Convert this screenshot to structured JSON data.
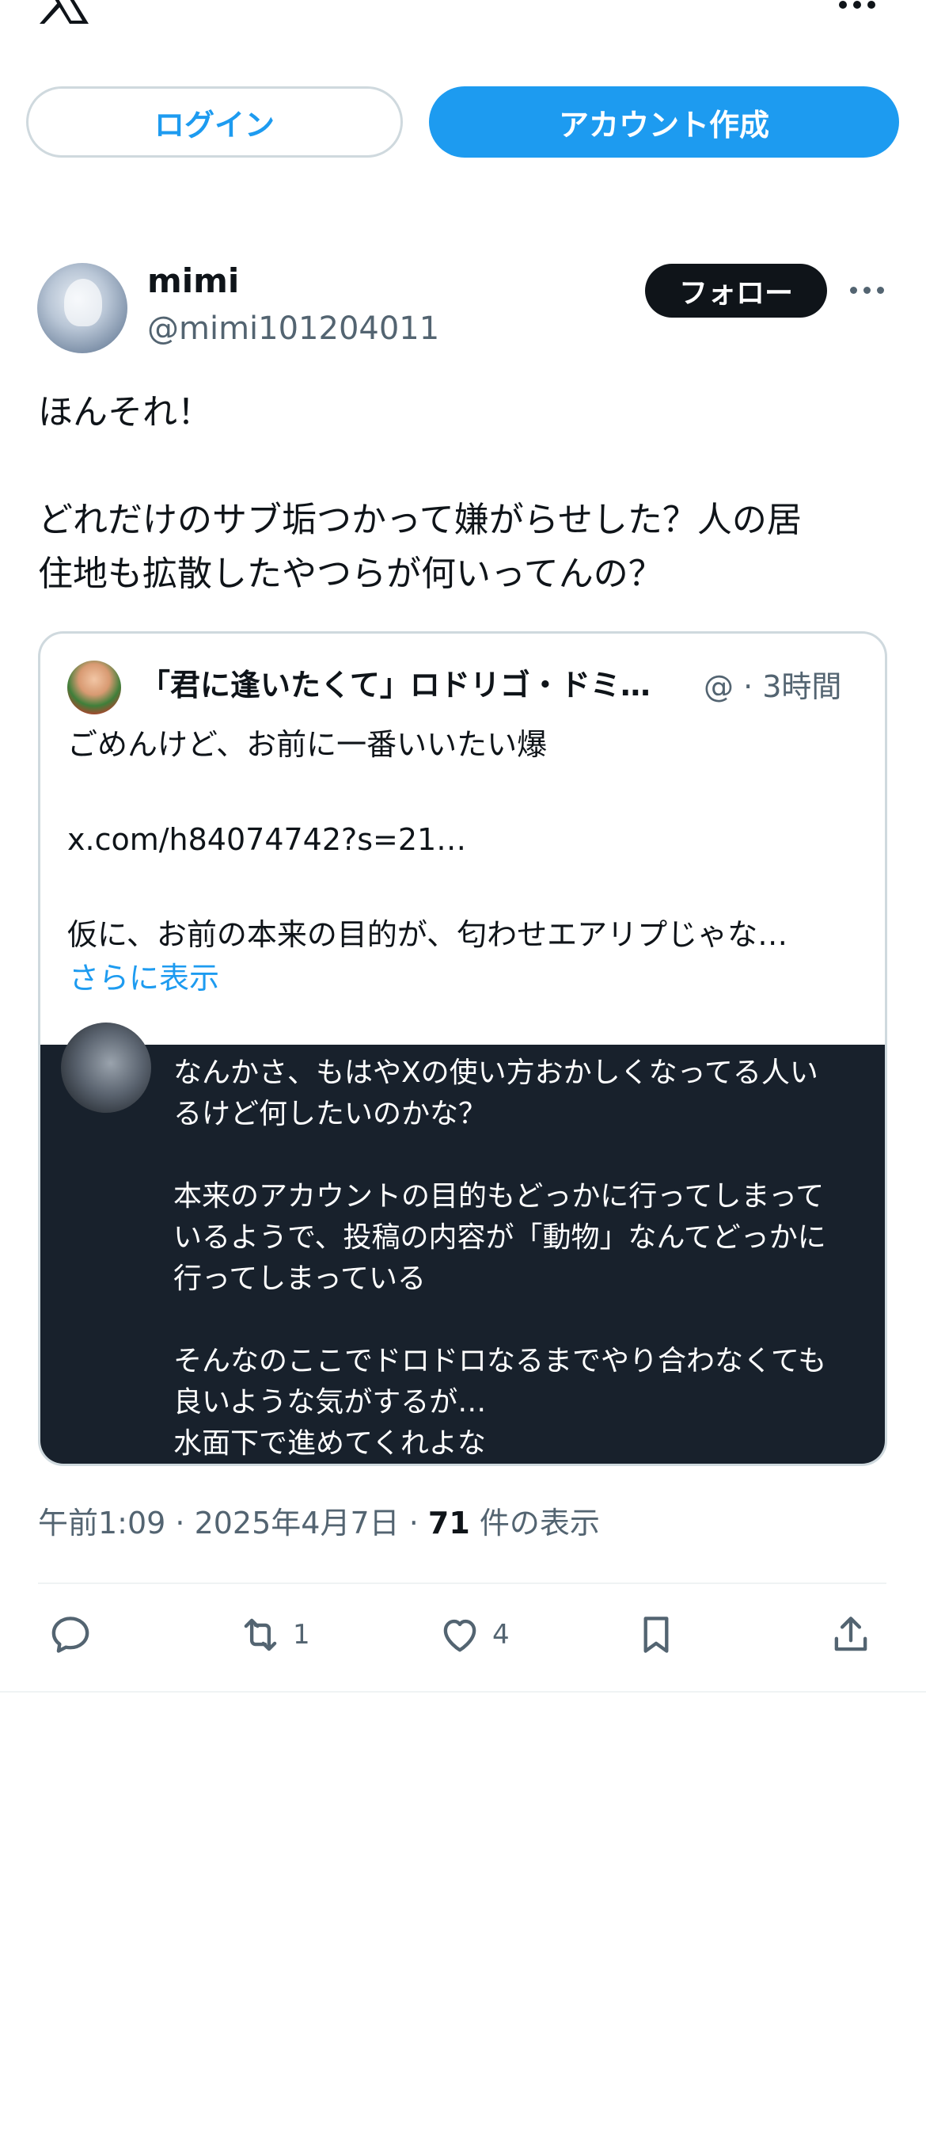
{
  "header": {
    "logo_icon": "x-logo-icon",
    "more_icon": "more-horizontal-icon",
    "login_label": "ログイン",
    "signup_label": "アカウント作成"
  },
  "post": {
    "author_name": "mimi",
    "author_handle": "@mimi101204011",
    "follow_label": "フォロー",
    "text": "ほんそれ！\n\nどれだけのサブ垢つかって嫌がらせした？人の居\n住地も拡散したやつらが何いってんの？",
    "timestamp_prefix": "午前1:09 · 2025年4月7日 · ",
    "views_count": "71",
    "views_suffix": " 件の表示"
  },
  "quote": {
    "author_name": "「君に逢いたくて」ロドリゴ・ドミ…",
    "meta": "@ · 3時間",
    "text": "ごめんけど、お前に一番いいたい爆\n\nx.com/h84074742?s=21…\n\n仮に、お前の本来の目的が、匂わせエアリプじゃな…",
    "show_more": "さらに表示",
    "embedded_text": "なんかさ、もはやXの使い方おかしくなってる人い\nるけど何したいのかな？\n\n本来のアカウントの目的もどっかに行ってしまって\nいるようで、投稿の内容が「動物」なんてどっかに\n行ってしまっている\n\nそんなのここでドロドロなるまでやり合わなくても\n良いような気がするが…\n水面下で進めてくれよな"
  },
  "actions": {
    "reply_icon": "reply-icon",
    "repost_icon": "repost-icon",
    "repost_count": "1",
    "like_icon": "heart-icon",
    "like_count": "4",
    "bookmark_icon": "bookmark-icon",
    "share_icon": "share-icon"
  },
  "colors": {
    "accent": "#1d9bf0",
    "text": "#0f1419",
    "secondary": "#536471",
    "dark_card": "#18212c"
  }
}
